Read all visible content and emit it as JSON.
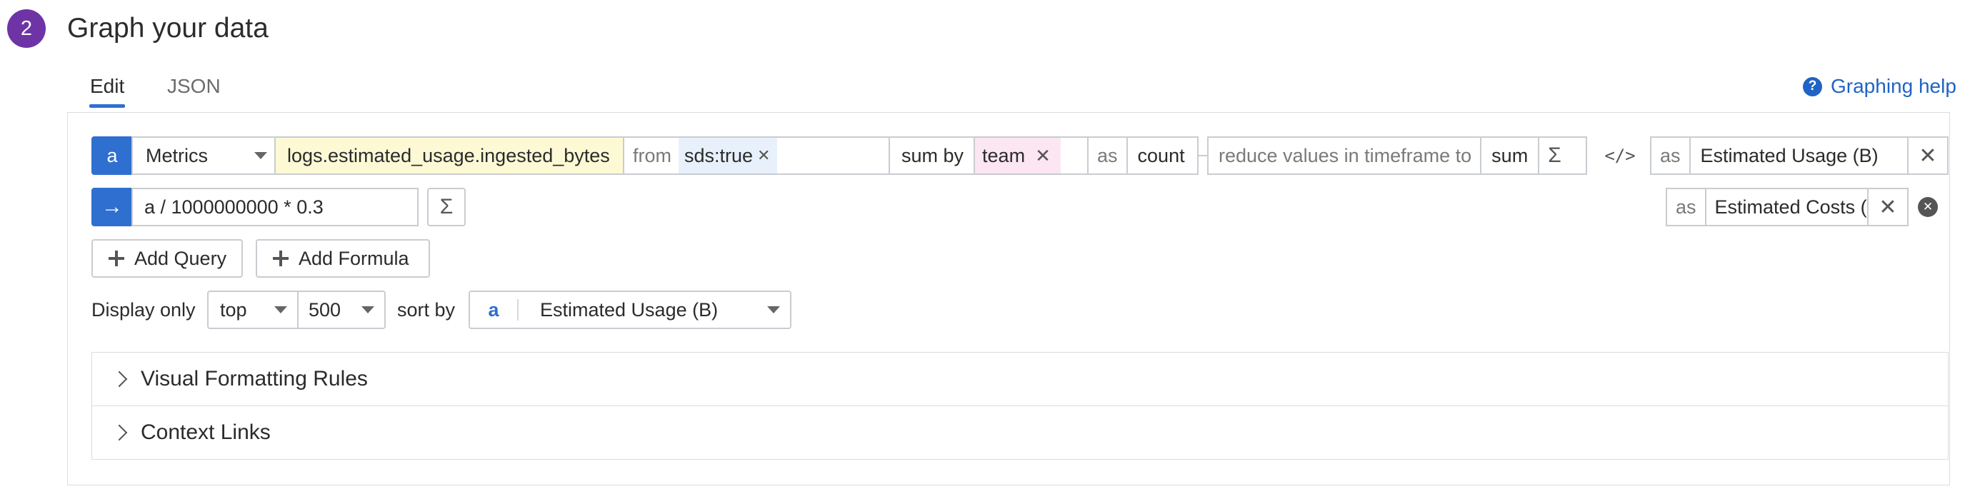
{
  "step": {
    "number": "2",
    "title": "Graph your data"
  },
  "tabs": [
    {
      "label": "Edit",
      "active": true
    },
    {
      "label": "JSON",
      "active": false
    }
  ],
  "help": {
    "label": "Graphing help",
    "icon": "question-circle-icon"
  },
  "query": {
    "letter": "a",
    "source": "Metrics",
    "metric": "logs.estimated_usage.ingested_bytes",
    "from_label": "from",
    "filter_tag": "sds:true",
    "sum_by_label": "sum by",
    "group_tag": "team",
    "as_label": "as",
    "as_type": "count",
    "reduce_label": "reduce values in timeframe to",
    "reduce_value": "sum",
    "alias_label": "as",
    "alias_value": "Estimated Usage (B)"
  },
  "formula": {
    "expression": "a / 1000000000 * 0.3",
    "alias_label": "as",
    "alias_value": "Estimated Costs ("
  },
  "buttons": {
    "add_query": "Add Query",
    "add_formula": "Add Formula"
  },
  "display": {
    "label": "Display only",
    "order": "top",
    "limit": "500",
    "sort_label": "sort by",
    "sort_letter": "a",
    "sort_value": "Estimated Usage (B)"
  },
  "sections": [
    "Visual Formatting Rules",
    "Context Links"
  ],
  "colors": {
    "accent": "#2f6fcf",
    "step": "#6e34a6",
    "metric_bg": "#fdf9d5",
    "tag_bg": "#e8f1fb",
    "group_bg": "#fbe6f2"
  }
}
